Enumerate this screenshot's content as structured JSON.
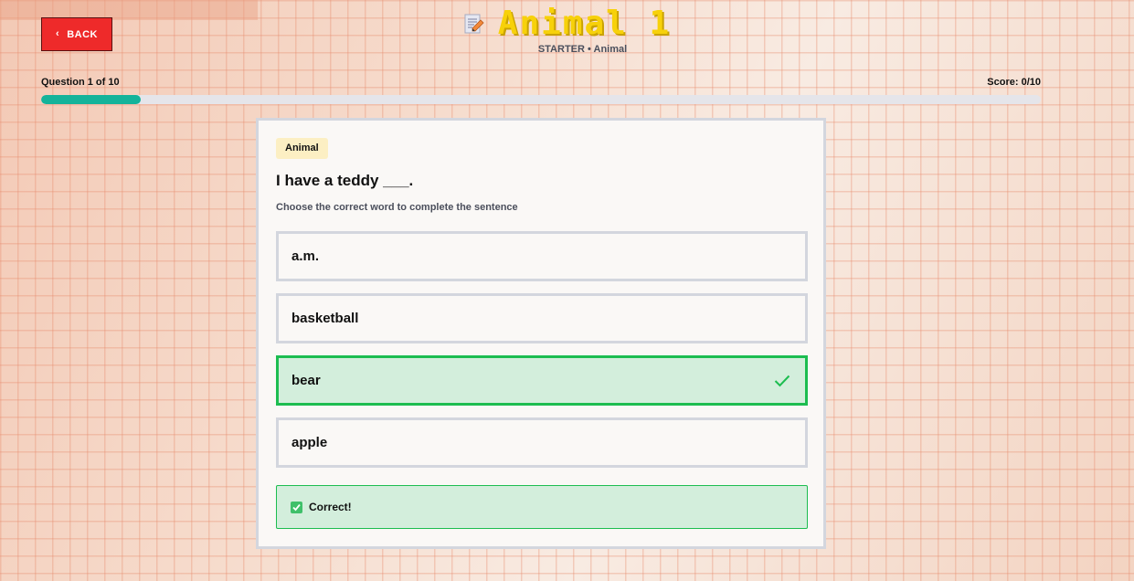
{
  "header": {
    "back_label": "BACK",
    "title": "Animal 1",
    "subtitle": "STARTER • Animal"
  },
  "progress": {
    "question_label": "Question 1 of 10",
    "score_label": "Score: 0/10",
    "fraction": 0.1
  },
  "question": {
    "category": "Animal",
    "text": "I have a teddy ___.",
    "instruction": "Choose the correct word to complete the sentence",
    "options": [
      {
        "label": "a.m."
      },
      {
        "label": "basketball"
      },
      {
        "label": "bear",
        "state": "correct"
      },
      {
        "label": "apple"
      }
    ],
    "feedback": "Correct!"
  },
  "colors": {
    "back_button": "#ee2a2a",
    "title": "#f7d10a",
    "progress": "#14b39a",
    "correct_border": "#1cbd50",
    "correct_bg": "#d3eedc"
  },
  "icons": {
    "back": "chevron-left-icon",
    "title": "memo-icon",
    "correct_option": "check-icon",
    "feedback": "checkbox-check-icon"
  }
}
